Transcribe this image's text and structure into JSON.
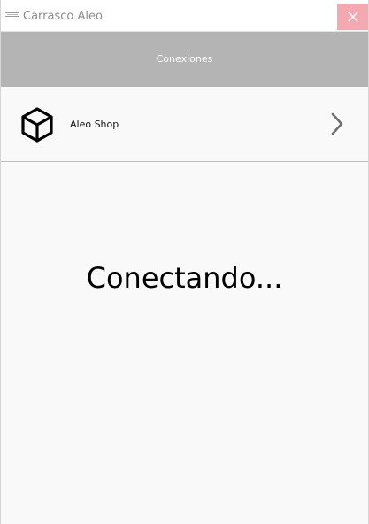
{
  "window": {
    "title": "Carrasco Aleo",
    "close_symbol": "✕",
    "icon": "app-logo-icon"
  },
  "header": {
    "title": "Conexiones"
  },
  "connections": [
    {
      "label": "Aleo Shop",
      "icon": "cube-icon",
      "action_icon": "chevron-right-icon"
    }
  ],
  "status": {
    "text": "Conectando..."
  },
  "colors": {
    "header_bg": "#b4b4b4",
    "close_bg": "#f4a8b0",
    "content_bg": "#f9f9f9"
  }
}
